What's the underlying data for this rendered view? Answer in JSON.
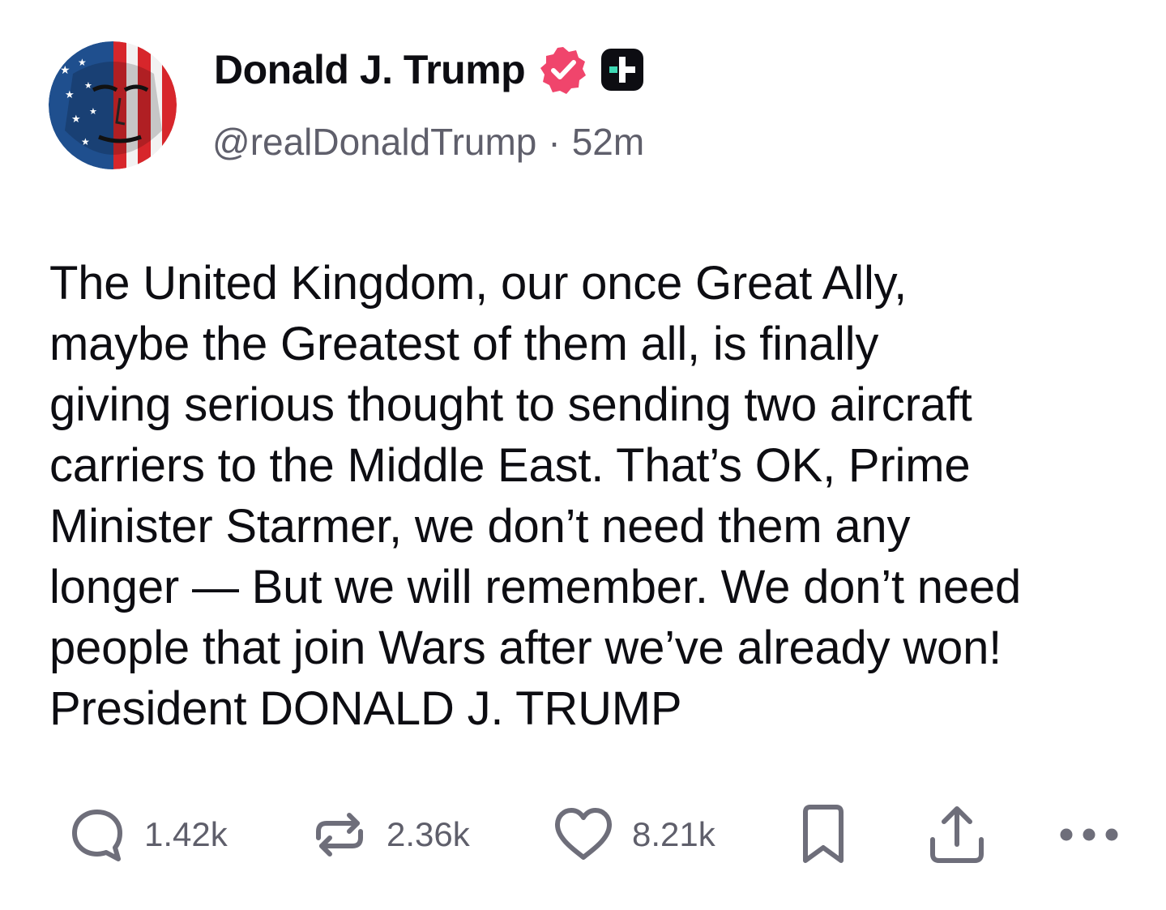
{
  "author": {
    "display_name": "Donald J. Trump",
    "handle": "@realDonaldTrump",
    "separator": "·",
    "time_ago": "52m",
    "avatar_icon": "flag-portrait-avatar",
    "verified_icon": "verified-badge-icon",
    "verified_color": "#f0456c",
    "plus_icon": "plus-badge-icon"
  },
  "post": {
    "text": "The United Kingdom, our once Great Ally,\nmaybe the Greatest of them all, is finally\ngiving serious thought to sending two aircraft\ncarriers to the Middle East. That’s OK, Prime\nMinister Starmer, we don’t need them any\nlonger — But we will remember. We don’t need\npeople that join Wars after we’ve already won!\nPresident DONALD J. TRUMP"
  },
  "actions": {
    "reply": {
      "icon": "reply-icon",
      "count": "1.42k"
    },
    "repost": {
      "icon": "repost-icon",
      "count": "2.36k"
    },
    "like": {
      "icon": "heart-icon",
      "count": "8.21k"
    },
    "bookmark": {
      "icon": "bookmark-icon"
    },
    "share": {
      "icon": "share-icon"
    },
    "more": {
      "icon": "more-icon"
    }
  },
  "colors": {
    "text": "#0d0d12",
    "muted": "#5f5f6b",
    "icon": "#6e6e7a",
    "verified": "#f0456c"
  }
}
